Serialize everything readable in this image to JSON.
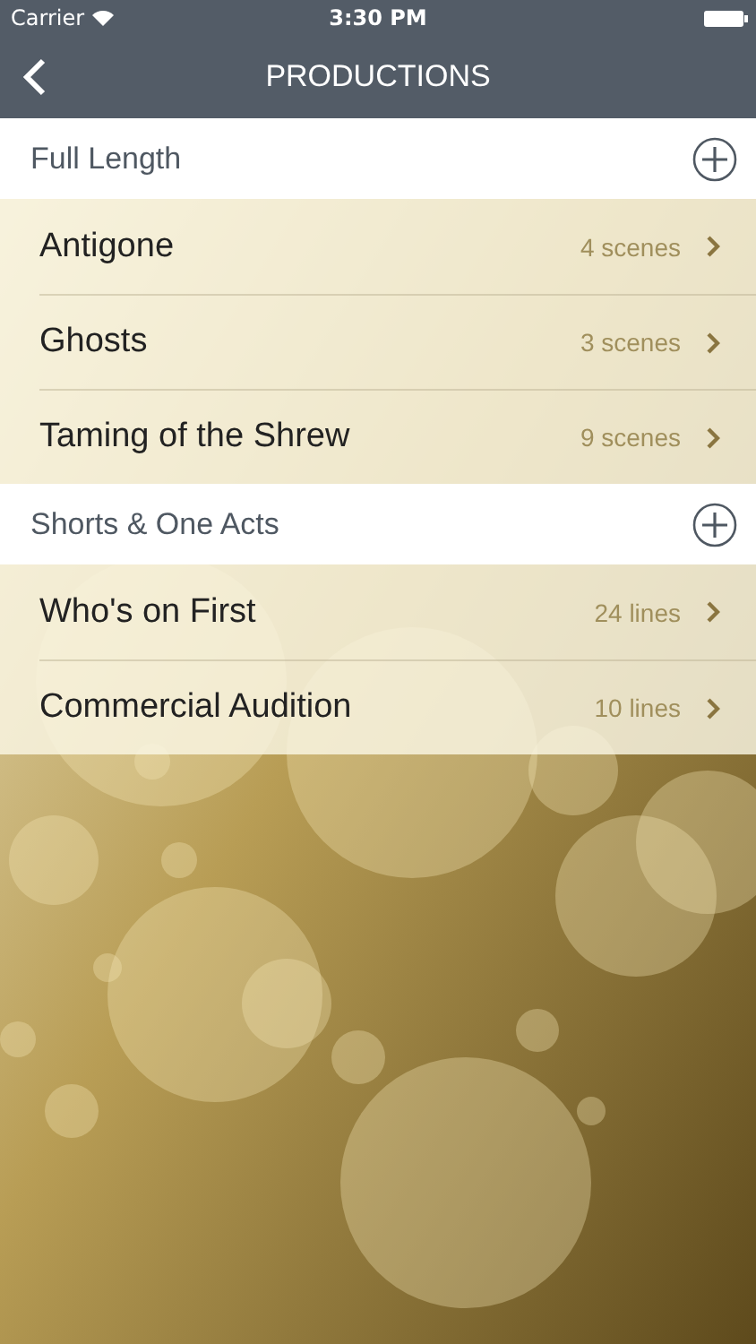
{
  "status_bar": {
    "carrier": "Carrier",
    "time": "3:30 PM"
  },
  "nav_bar": {
    "title": "PRODUCTIONS"
  },
  "sections": [
    {
      "title": "Full Length",
      "items": [
        {
          "title": "Antigone",
          "detail": "4 scenes"
        },
        {
          "title": "Ghosts",
          "detail": "3 scenes"
        },
        {
          "title": "Taming of the Shrew",
          "detail": "9 scenes"
        }
      ]
    },
    {
      "title": "Shorts & One Acts",
      "items": [
        {
          "title": "Who's on First",
          "detail": "24 lines"
        },
        {
          "title": "Commercial Audition",
          "detail": "10 lines"
        }
      ]
    }
  ]
}
